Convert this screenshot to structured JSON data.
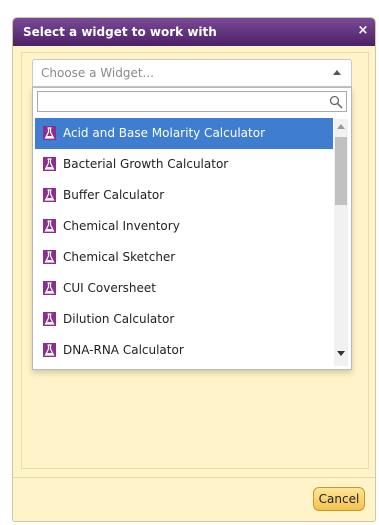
{
  "dialog": {
    "title": "Select a widget to work with",
    "close_label": "×",
    "cancel_label": "Cancel"
  },
  "select": {
    "placeholder": "Choose a Widget...",
    "search_value": ""
  },
  "widgets": [
    "Acid and Base Molarity Calculator",
    "Bacterial Growth Calculator",
    "Buffer Calculator",
    "Chemical Inventory",
    "Chemical Sketcher",
    "CUI Coversheet",
    "Dilution Calculator",
    "DNA-RNA Calculator"
  ],
  "selected_index": 0,
  "item_icon": "flask-icon",
  "colors": {
    "titlebar": "#5e2d7a",
    "dialog_bg": "#fff4c9",
    "selected_bg": "#3f7dd1",
    "button": "#f6c85a",
    "icon_bg": "#8b2f8f"
  }
}
